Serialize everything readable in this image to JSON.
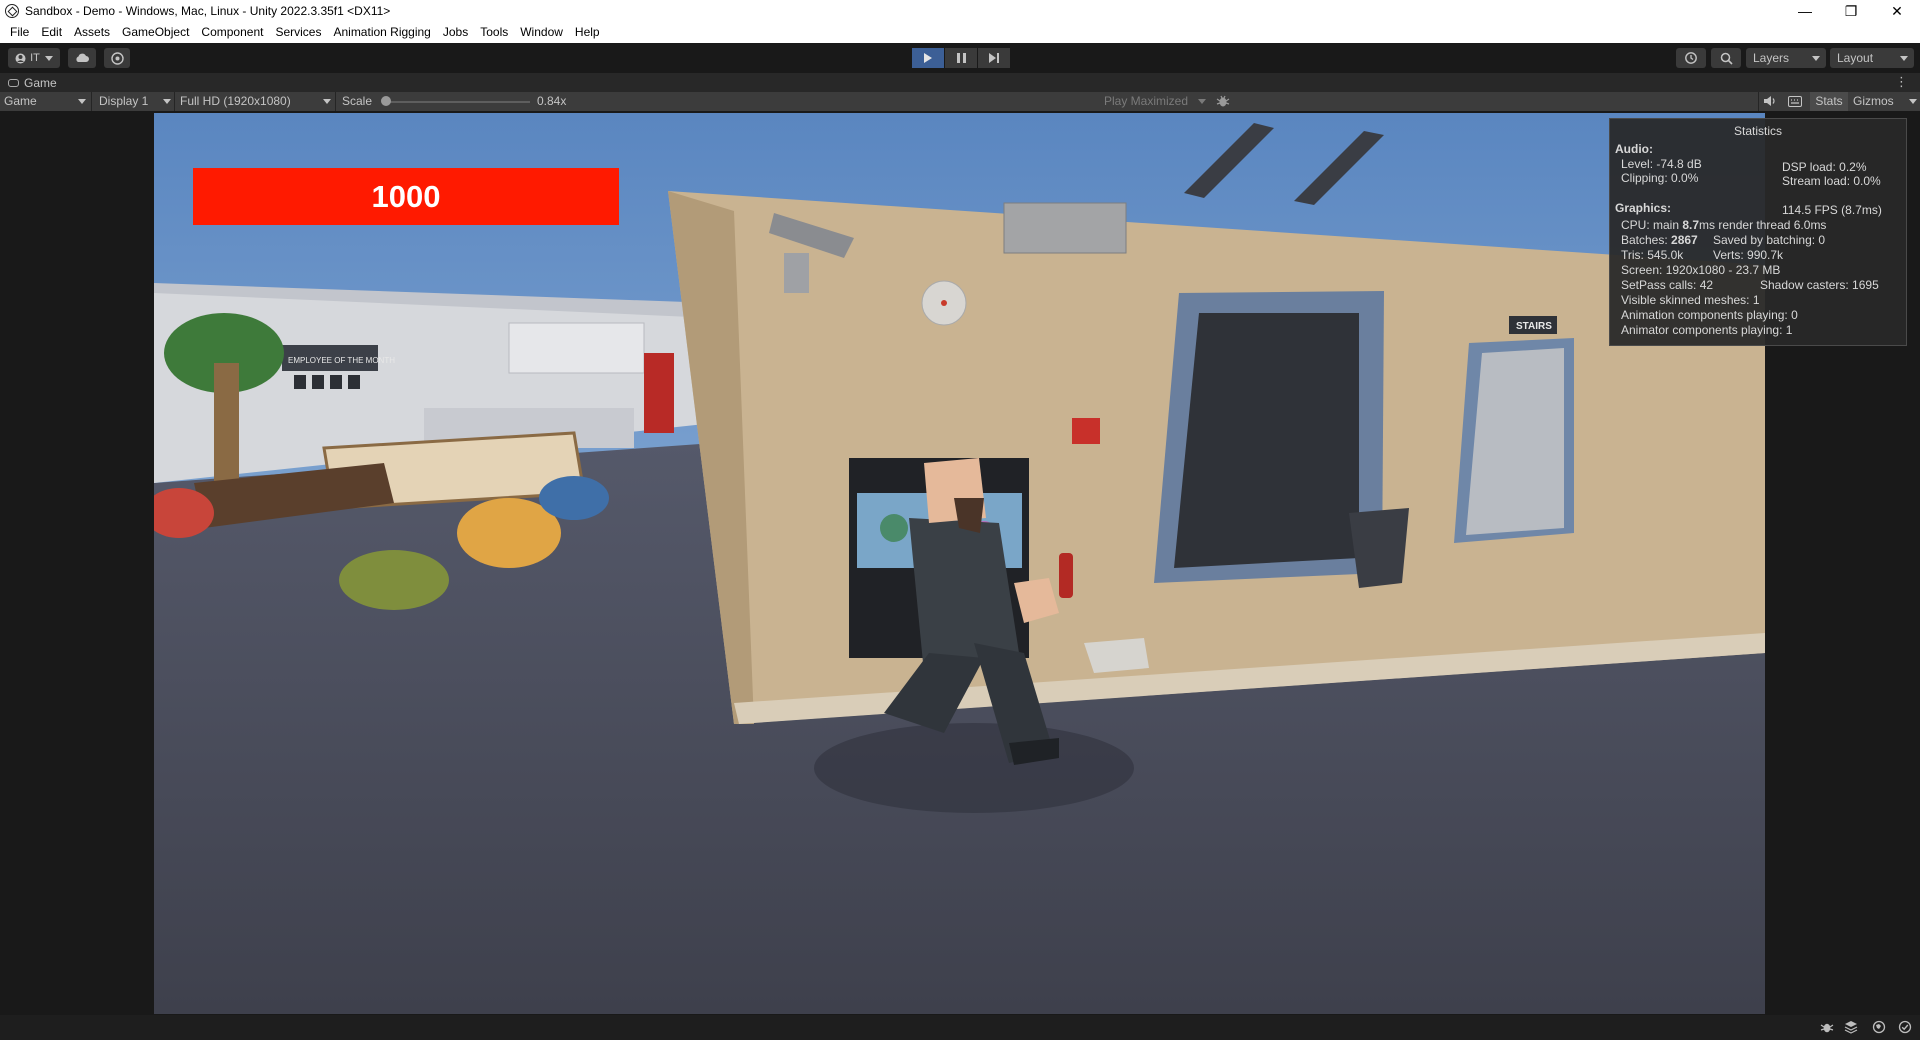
{
  "window": {
    "title": "Sandbox - Demo - Windows, Mac, Linux - Unity 2022.3.35f1 <DX11>",
    "minimize": "—",
    "restore": "❐",
    "close": "✕"
  },
  "menu": [
    "File",
    "Edit",
    "Assets",
    "GameObject",
    "Component",
    "Services",
    "Animation Rigging",
    "Jobs",
    "Tools",
    "Window",
    "Help"
  ],
  "toolbar": {
    "account_label": "IT",
    "layers_label": "Layers",
    "layout_label": "Layout",
    "play_active": true
  },
  "game_tab": {
    "label": "Game"
  },
  "game_bar": {
    "view_mode": "Game",
    "display": "Display 1",
    "resolution": "Full HD (1920x1080)",
    "scale_label": "Scale",
    "scale_value": "0.84x",
    "play_mode": "Play Maximized",
    "stats_label": "Stats",
    "gizmos_label": "Gizmos"
  },
  "hud": {
    "score": "1000",
    "score_color": "#ff1a00"
  },
  "stats": {
    "title": "Statistics",
    "audio_header": "Audio:",
    "level": "Level: -74.8 dB",
    "clipping": "Clipping: 0.0%",
    "dsp_load": "DSP load: 0.2%",
    "stream_load": "Stream load: 0.0%",
    "graphics_header": "Graphics:",
    "fps": "114.5 FPS (8.7ms)",
    "cpu_prefix": "CPU: main ",
    "cpu_main": "8.7",
    "cpu_suffix": "ms  render thread 6.0ms",
    "batches_prefix": "Batches: ",
    "batches": "2867",
    "saved_by_batching": "Saved by batching: 0",
    "tris": "Tris: 545.0k",
    "verts": "Verts: 990.7k",
    "screen": "Screen: 1920x1080 - 23.7 MB",
    "setpass": "SetPass calls: 42",
    "shadow_casters": "Shadow casters: 1695",
    "skinned_meshes": "Visible skinned meshes: 1",
    "animation_components": "Animation components playing: 0",
    "animator_components": "Animator components playing: 1"
  },
  "scene_labels": {
    "employee_sign": "EMPLOYEE OF THE MONTH",
    "stairs_sign": "STAIRS"
  },
  "colors": {
    "play_accent": "#3c5f96",
    "editor_bg": "#191919",
    "panel_bg": "#282828"
  }
}
